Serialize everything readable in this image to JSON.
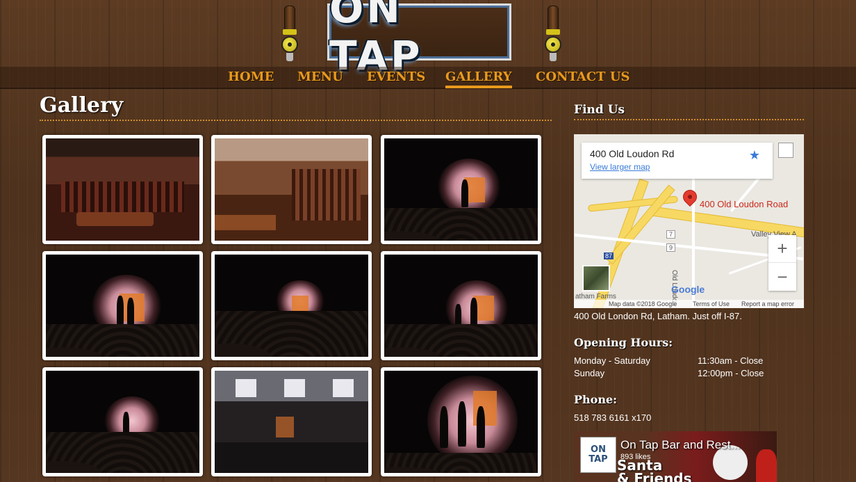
{
  "site": {
    "logo_text": "ON TAP"
  },
  "nav": {
    "items": [
      {
        "label": "HOME",
        "active": false
      },
      {
        "label": "MENU",
        "active": false
      },
      {
        "label": "EVENTS",
        "active": false
      },
      {
        "label": "GALLERY",
        "active": true
      },
      {
        "label": "CONTACT US",
        "active": false
      }
    ]
  },
  "main": {
    "title": "Gallery",
    "gallery_count": 9
  },
  "sidebar": {
    "find_us": {
      "heading": "Find Us",
      "map": {
        "card_address": "400 Old Loudon Rd",
        "card_link": "View larger map",
        "pin_label": "400 Old Loudon Road",
        "road_label_1": "Old Loudon Rd",
        "place_label_1": "Valley View A",
        "place_label_2": "atham Farms",
        "shield_7": "7",
        "shield_9": "9",
        "shield_87": "87",
        "google": "Google",
        "footer_data": "Map data ©2018 Google",
        "footer_terms": "Terms of Use",
        "footer_report": "Report a map error",
        "zoom_in": "+",
        "zoom_out": "−"
      },
      "address_line": "400 Old London Rd, Latham. Just off I-87."
    },
    "hours": {
      "heading": "Opening Hours:",
      "rows": [
        {
          "days": "Monday - Saturday",
          "time": "11:30am - Close"
        },
        {
          "days": "Sunday",
          "time": "12:00pm - Close"
        }
      ]
    },
    "phone": {
      "heading": "Phone:",
      "number": "518 783 6161 x170"
    },
    "facebook": {
      "name": "On Tap Bar and Rest...",
      "likes": "893 likes",
      "logo_text": "ON TAP",
      "banner": "Santa\n& Friends"
    }
  },
  "colors": {
    "accent": "#e8991c",
    "wood": "#4e321d"
  }
}
